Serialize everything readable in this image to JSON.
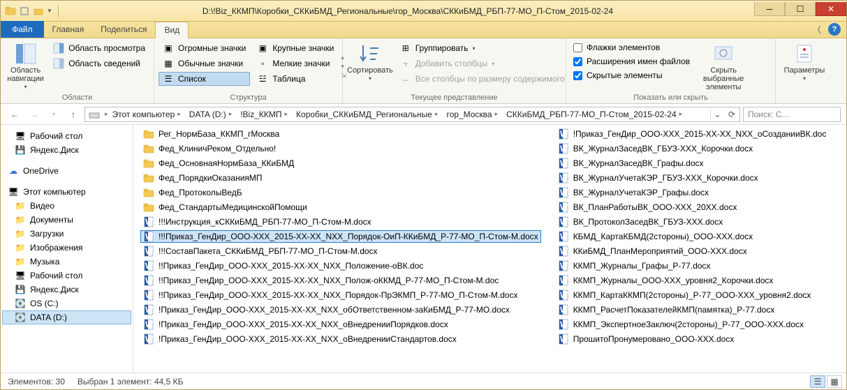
{
  "titlebar": {
    "path": "D:\\!Biz_ККМП\\Коробки_СККиБМД_Региональные\\гор_Москва\\СККиБМД_РБП-77-МО_П-Стом_2015-02-24"
  },
  "tabs": {
    "file": "Файл",
    "home": "Главная",
    "share": "Поделиться",
    "view": "Вид"
  },
  "ribbon": {
    "panes": {
      "nav_area": "Область навигации",
      "preview": "Область просмотра",
      "details": "Область сведений",
      "group_label": "Области"
    },
    "layout": {
      "extra_large": "Огромные значки",
      "large": "Крупные значки",
      "medium": "Обычные значки",
      "small": "Мелкие значки",
      "list": "Список",
      "table": "Таблица",
      "group_label": "Структура"
    },
    "view": {
      "sort": "Сортировать",
      "group_by": "Группировать",
      "add_columns": "Добавить столбцы",
      "size_all": "Все столбцы по размеру содержимого",
      "group_label": "Текущее представление"
    },
    "showhide": {
      "item_check": "Флажки элементов",
      "file_ext": "Расширения имен файлов",
      "hidden": "Скрытые элементы",
      "hide_selected": "Скрыть выбранные элементы",
      "group_label": "Показать или скрыть"
    },
    "options": {
      "options": "Параметры"
    }
  },
  "breadcrumb": {
    "items": [
      "Этот компьютер",
      "DATA (D:)",
      "!Biz_ККМП",
      "Коробки_СККиБМД_Региональные",
      "гор_Москва",
      "СККиБМД_РБП-77-МО_П-Стом_2015-02-24"
    ]
  },
  "search": {
    "placeholder": "Поиск: С..."
  },
  "tree": {
    "desktop": "Рабочий стол",
    "yadisk": "Яндекс.Диск",
    "onedrive": "OneDrive",
    "thispc": "Этот компьютер",
    "videos": "Видео",
    "documents": "Документы",
    "downloads": "Загрузки",
    "pictures": "Изображения",
    "music": "Музыка",
    "desktop2": "Рабочий стол",
    "yadisk2": "Яндекс.Диск",
    "osc": "OS (C:)",
    "datad": "DATA (D:)"
  },
  "files_left": [
    {
      "type": "folder",
      "name": "Рег_НормБаза_ККМП_гМосква"
    },
    {
      "type": "folder",
      "name": "Фед_КлиничРеком_Отдельно!"
    },
    {
      "type": "folder",
      "name": "Фед_ОсновнаяНормБаза_ККиБМД"
    },
    {
      "type": "folder",
      "name": "Фед_ПорядкиОказанияМП"
    },
    {
      "type": "folder",
      "name": "Фед_ПротоколыВедБ"
    },
    {
      "type": "folder",
      "name": "Фед_СтандартыМедицинскойПомощи"
    },
    {
      "type": "word",
      "name": "!!!Инструкция_кСККиБМД_РБП-77-МО_П-Стом-М.docx"
    },
    {
      "type": "word",
      "name": "!!!Приказ_ГенДир_ООО-ХХХ_2015-ХХ-ХХ_NХХ_Порядок-ОиП-ККиБМД_Р-77-МО_П-Стом-М.docx",
      "selected": true
    },
    {
      "type": "word",
      "name": "!!!СоставПакета_СККиБМД_РБП-77-МО_П-Стом-М.docx"
    },
    {
      "type": "word",
      "name": "!!Приказ_ГенДир_ООО-ХХХ_2015-ХХ-ХХ_NХХ_Положение-оВК.doc"
    },
    {
      "type": "word",
      "name": "!!Приказ_ГенДир_ООО-ХХХ_2015-ХХ-ХХ_NХХ_Полож-оККМД_Р-77-МО_П-Стом-М.doc"
    },
    {
      "type": "word",
      "name": "!!Приказ_ГенДир_ООО-ХХХ_2015-ХХ-ХХ_NХХ_Порядок-ПрЭКМП_Р-77-МО_П-Стом-М.docx"
    },
    {
      "type": "word",
      "name": "!Приказ_ГенДир_ООО-ХХХ_2015-ХХ-ХХ_NХХ_обОтветственном-заКиБМД_Р-77-МО.docx"
    },
    {
      "type": "word",
      "name": "!Приказ_ГенДир_ООО-ХХХ_2015-ХХ-ХХ_NХХ_оВнедренииПорядков.docx"
    },
    {
      "type": "word",
      "name": "!Приказ_ГенДир_ООО-ХХХ_2015-ХХ-ХХ_NХХ_оВнедренииСтандартов.docx"
    }
  ],
  "files_right": [
    {
      "type": "word",
      "name": "!Приказ_ГенДир_ООО-ХХХ_2015-ХХ-ХХ_NХХ_оСозданииВК.doc"
    },
    {
      "type": "word",
      "name": "ВК_ЖурналЗаседВК_ГБУЗ-ХХХ_Корочки.docx"
    },
    {
      "type": "word",
      "name": "ВК_ЖурналЗаседВК_Графы.docx"
    },
    {
      "type": "word",
      "name": "ВК_ЖурналУчетаКЭР_ГБУЗ-ХХХ_Корочки.docx"
    },
    {
      "type": "word",
      "name": "ВК_ЖурналУчетаКЭР_Графы.docx"
    },
    {
      "type": "word",
      "name": "ВК_ПланРаботыВК_ООО-ХХХ_20ХХ.docx"
    },
    {
      "type": "word",
      "name": "ВК_ПротоколЗаседВК_ГБУЗ-ХХХ.docx"
    },
    {
      "type": "word",
      "name": "КБМД_КартаКБМД(2стороны)_ООО-ХХХ.docx"
    },
    {
      "type": "word",
      "name": "ККиБМД_ПланМероприятий_ООО-ХХХ.docx"
    },
    {
      "type": "word",
      "name": "ККМП_Журналы_Графы_Р-77.docx"
    },
    {
      "type": "word",
      "name": "ККМП_Журналы_ООО-ХХХ_уровня2_Корочки.docx"
    },
    {
      "type": "word",
      "name": "ККМП_КартаККМП(2стороны)_Р-77_ООО-ХХХ_уровня2.docx"
    },
    {
      "type": "word",
      "name": "ККМП_РасчетПоказателейКМП(памятка)_Р-77.docx"
    },
    {
      "type": "word",
      "name": "ККМП_ЭкспертноеЗаключ(2стороны)_Р-77_ООО-ХХХ.docx"
    },
    {
      "type": "word",
      "name": "ПрошитоПронумеровано_ООО-ХХХ.docx"
    }
  ],
  "status": {
    "elements": "Элементов: 30",
    "selected": "Выбран 1 элемент: 44,5 КБ"
  }
}
